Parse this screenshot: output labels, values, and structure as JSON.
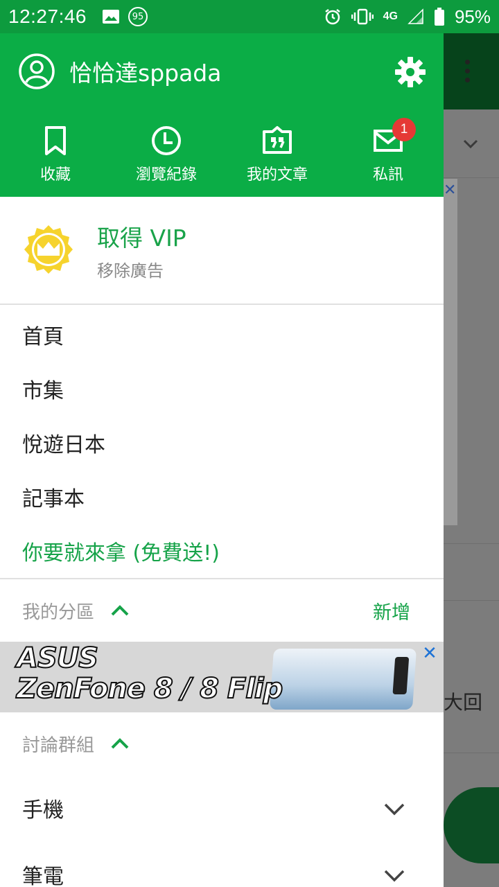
{
  "status_bar": {
    "time": "12:27:46",
    "notification_count": "95",
    "network": "4G",
    "battery": "95%"
  },
  "drawer": {
    "username": "恰恰達sppada",
    "quick_actions": [
      {
        "label": "收藏",
        "icon": "bookmark-icon"
      },
      {
        "label": "瀏覽紀錄",
        "icon": "clock-icon"
      },
      {
        "label": "我的文章",
        "icon": "quote-icon"
      },
      {
        "label": "私訊",
        "icon": "mail-icon",
        "badge": "1"
      }
    ],
    "vip": {
      "title": "取得 VIP",
      "subtitle": "移除廣告"
    },
    "menu": [
      "首頁",
      "市集",
      "悅遊日本",
      "記事本"
    ],
    "promo": "你要就來拿 (免費送!)",
    "my_boards": {
      "title": "我的分區",
      "action": "新增"
    },
    "ad": {
      "line1": "ASUS",
      "line2": "ZenFone 8 / 8 Flip",
      "close": "✕"
    },
    "groups": {
      "title": "討論群組",
      "items": [
        "手機",
        "筆電"
      ]
    }
  },
  "background": {
    "visible_text": "大回"
  },
  "colors": {
    "primary_green": "#0bad46",
    "status_bar": "#0d9b3e",
    "badge_red": "#e53935",
    "vip_gold": "#f6d32d"
  }
}
